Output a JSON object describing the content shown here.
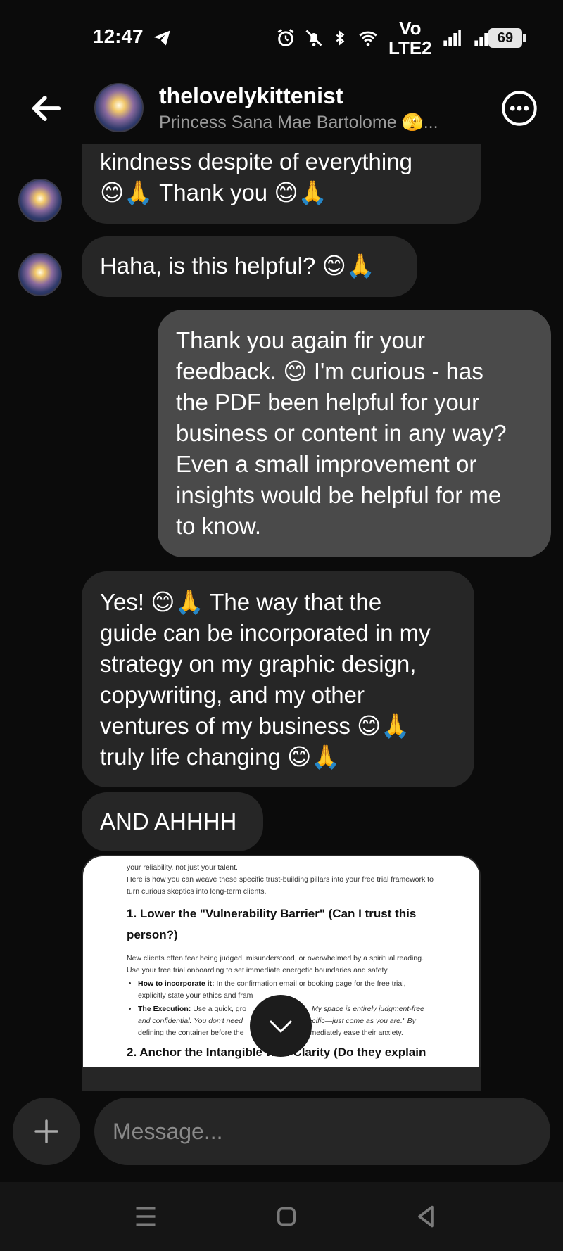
{
  "status_bar": {
    "time": "12:47",
    "volte_top": "Vo",
    "volte_bottom": "LTE2",
    "battery": "69",
    "icons": [
      "telegram-icon",
      "alarm-icon",
      "mute-icon",
      "bluetooth-icon",
      "wifi-icon",
      "volte-icon",
      "signal-icon",
      "signal-icon",
      "battery-icon"
    ]
  },
  "header": {
    "username": "thelovelykittenist",
    "subtitle": "Princess Sana Mae Bartolome 🫣..."
  },
  "messages": [
    {
      "direction": "incoming",
      "lines": [
        "kindness despite of everything",
        "😊🙏 Thank you 😊🙏"
      ]
    },
    {
      "direction": "incoming",
      "text": "Haha, is this helpful? 😊🙏"
    },
    {
      "direction": "outgoing",
      "lines": [
        "Thank you again fir your",
        "feedback. 😊 I'm curious - has",
        "the PDF been helpful for your",
        "business or content in any way?",
        "Even a small improvement or",
        "insights would be helpful for me",
        "to know."
      ]
    },
    {
      "direction": "incoming",
      "lines": [
        "Yes! 😊🙏 The way that the",
        "guide can be incorporated in my",
        "strategy on my graphic design,",
        "copywriting, and my other",
        "ventures of my business 😊🙏",
        "truly life changing 😊🙏"
      ]
    },
    {
      "direction": "incoming",
      "text": "AND AHHHH"
    }
  ],
  "attachment": {
    "intro_1": "your reliability, not just your talent.",
    "intro_2": "Here is how you can weave these specific trust-building pillars into your free trial framework to",
    "intro_3": "turn curious skeptics into long-term clients.",
    "heading_1": "1. Lower the \"Vulnerability Barrier\" (Can I trust this",
    "heading_1b": "person?)",
    "para_1": "New clients often fear being judged, misunderstood, or overwhelmed by a spiritual reading.",
    "para_2": "Use your free trial onboarding to set immediate energetic boundaries and safety.",
    "bullet_1_label": "How to incorporate it:",
    "bullet_1_text": "In the confirmation email or booking page for the free trial,",
    "bullet_1_text2": "explicitly state your ethics and fram",
    "bullet_2_label": "The Execution:",
    "bullet_2_text": "Use a quick, gro",
    "bullet_2_text_b": "My space is entirely judgment-free",
    "bullet_2_text2": "and confidential. You don't need",
    "bullet_2_text2_b": "g specific—just come as you are.\" By",
    "bullet_2_text3": "defining the container before the",
    "bullet_2_text3_b": "you immediately ease their anxiety.",
    "heading_2": "2. Anchor the Intangible with Clarity (Do they explain"
  },
  "composer": {
    "placeholder": "Message..."
  }
}
